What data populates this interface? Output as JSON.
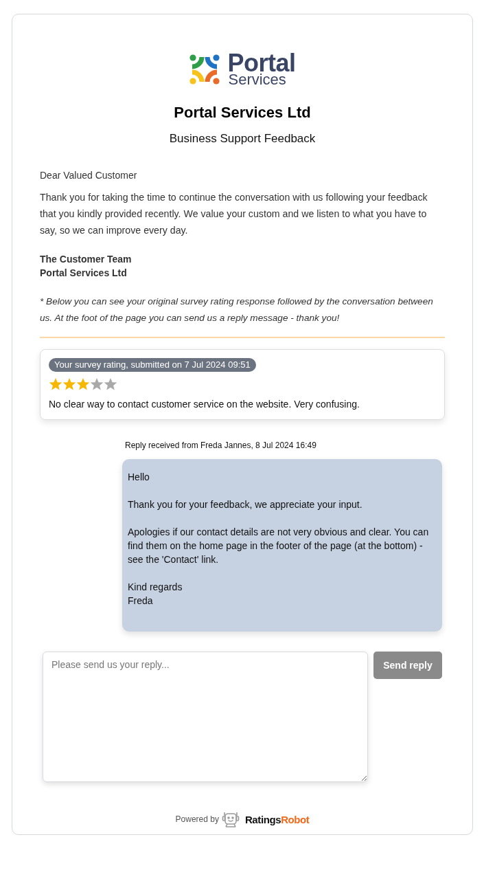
{
  "header": {
    "logo": {
      "line_1": "Portal",
      "line_2": "Services"
    },
    "title": "Portal Services Ltd",
    "subtitle": "Business Support Feedback"
  },
  "letter": {
    "greeting": "Dear Valued Customer",
    "body": "Thank you for taking the time to continue the conversation with us following your feedback that you kindly provided recently. We value your custom and we listen to what you have to say, so we can improve every day.",
    "signature": [
      "The Customer Team",
      "Portal Services Ltd"
    ],
    "note": "* Below you can see your original survey rating response followed by the conversation between us. At the foot of the page you can send us a reply message - thank you!"
  },
  "rating": {
    "label": "Your survey rating, submitted on 7 Jul 2024 09:51",
    "stars": 3,
    "comment": "No clear way to contact customer service on the website. Very confusing."
  },
  "conversation": [
    {
      "kind": "staff_reply",
      "heading": "Reply received from Freda Jannes, 8 Jul 2024 16:49",
      "message": "Hello\n\nThank you for your feedback, we appreciate your input.\n\nApologies if our contact details are not very obvious and clear. You can find them on the home page in the footer of the page (at the bottom) - see the 'Contact' link.\n\nKind regards\nFreda"
    }
  ],
  "reply_form": {
    "placeholder": "Please send us your reply...",
    "button": {
      "label": "Send reply",
      "disabled": true
    }
  },
  "footer": {
    "powered_by": "Powered by",
    "brand": [
      {
        "text": "Ratings",
        "color": "#111111"
      },
      {
        "text": "Robot",
        "color": "#f26a1b"
      }
    ]
  }
}
